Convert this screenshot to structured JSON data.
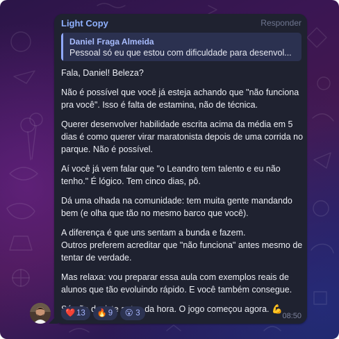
{
  "colors": {
    "bubble": "#1f2230",
    "channel_name": "#8fb1ff",
    "quote_bar": "#8fa8ff",
    "reaction_bg": "#2c3352",
    "reaction_text": "#a7b6ff"
  },
  "header": {
    "channel_name": "Light Copy",
    "reply_label": "Responder"
  },
  "quote": {
    "author": "Daniel Fraga Almeida",
    "text": "Pessoal só eu que estou com dificuldade para desenvol..."
  },
  "message": {
    "paragraphs": [
      "Fala, Daniel! Beleza?",
      "Não é possível que você já esteja achando que \"não funciona pra você\". Isso é falta de estamina, não de técnica.",
      "Querer desenvolver habilidade escrita acima da média em 5 dias é como querer virar maratonista depois de uma corrida no parque. Não é possível.",
      "Aí você já vem falar que \"o Leandro tem talento e eu não tenho.\" É lógico. Tem cinco dias, pô.",
      "Dá uma olhada na comunidade: tem muita gente mandando bem (e olha que tão no mesmo barco que você).",
      "A diferença é que uns sentam a bunda e fazem.",
      "Outros preferem acreditar que \"não funciona\" antes mesmo de tentar de verdade.",
      "Mas relaxa: vou preparar essa aula com exemplos reais de alunos que tão evoluindo rápido. E você também consegue.",
      "Só não desiste antes da hora. O jogo começou agora. 💪"
    ],
    "time": "08:50"
  },
  "reactions": [
    {
      "icon": "heart-icon",
      "emoji": "❤️",
      "count": "13"
    },
    {
      "icon": "fire-icon",
      "emoji": "🔥",
      "count": "9"
    },
    {
      "icon": "surprised-face-icon",
      "emoji": "😮",
      "count": "3"
    }
  ],
  "avatar": {
    "icon": "avatar"
  }
}
